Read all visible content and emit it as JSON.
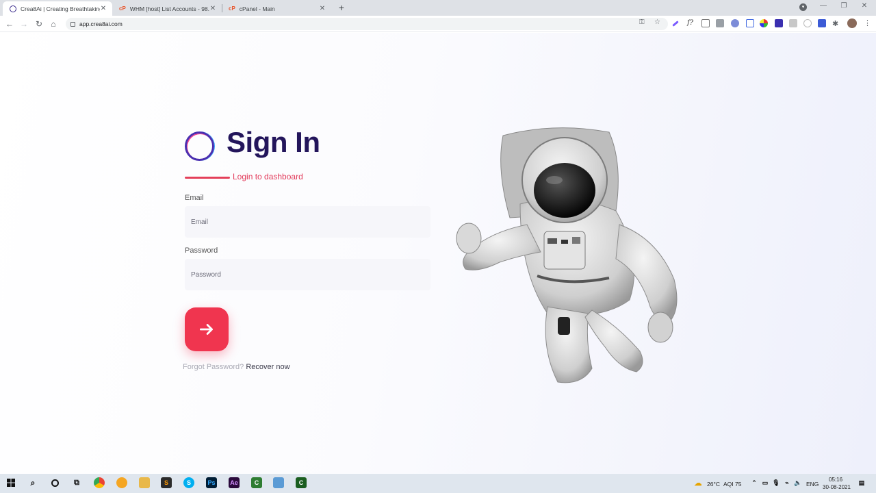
{
  "browser": {
    "tabs": [
      {
        "title": "Crea8Ai | Creating Breathtaking S",
        "active": true,
        "favicon": "crea8ai-ring-icon"
      },
      {
        "title": "WHM [host] List Accounts - 98.0",
        "active": false,
        "favicon": "cpanel-icon"
      },
      {
        "title": "cPanel - Main",
        "active": false,
        "favicon": "cpanel-icon"
      }
    ],
    "new_tab": "+",
    "url": "app.crea8ai.com"
  },
  "login": {
    "heading": "Sign In",
    "subtitle": "Login to dashboard",
    "email_label": "Email",
    "email_placeholder": "Email",
    "password_label": "Password",
    "password_placeholder": "Password",
    "submit_icon": "arrow-right-icon",
    "forgot_text": "Forgot Password?",
    "recover_link": "Recover now"
  },
  "colors": {
    "accent": "#f0354f",
    "heading": "#23155b",
    "subtitle": "#e23a5a"
  },
  "taskbar": {
    "weather": "26°C",
    "aqi": "AQI 75",
    "language": "ENG",
    "time": "05:16",
    "date": "30-08-2021"
  }
}
